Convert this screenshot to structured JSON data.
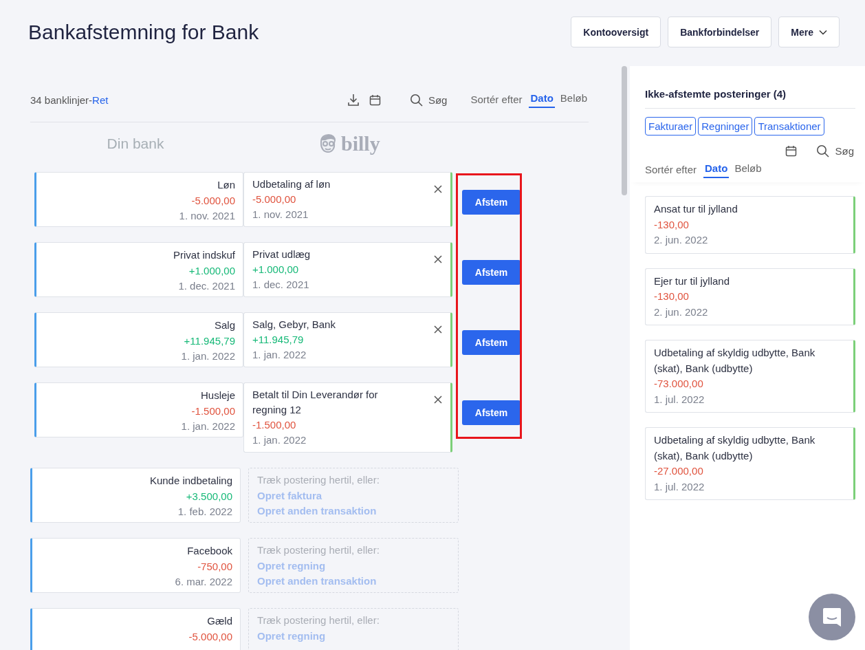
{
  "page": {
    "title": "Bankafstemning for Bank"
  },
  "header_buttons": [
    {
      "label": "Kontooversigt",
      "kind": "plain"
    },
    {
      "label": "Bankforbindelser",
      "kind": "plain"
    },
    {
      "label": "Mere",
      "kind": "dropdown"
    }
  ],
  "toolbar": {
    "count": "34 banklinjer-",
    "edit_link": "Ret",
    "search": "Søg",
    "sort_label": "Sortér efter",
    "sort_options": [
      {
        "label": "Dato",
        "selected": true
      },
      {
        "label": "Beløb",
        "selected": false
      }
    ]
  },
  "columns": {
    "bank": "Din bank",
    "billy": "billy"
  },
  "matched": [
    {
      "bank": {
        "name": "Løn",
        "amount": "-5.000,00",
        "color": "#e0533e",
        "date": "1. nov. 2021"
      },
      "entry": {
        "name": "Udbetaling af løn",
        "amount": "-5.000,00",
        "color": "#e0533e",
        "date": "1. nov. 2021"
      },
      "button": "Afstem"
    },
    {
      "bank": {
        "name": "Privat indskuf",
        "amount": "+1.000,00",
        "color": "#17b978",
        "date": "1. dec. 2021"
      },
      "entry": {
        "name": "Privat udlæg",
        "amount": "+1.000,00",
        "color": "#17b978",
        "date": "1. dec. 2021"
      },
      "button": "Afstem"
    },
    {
      "bank": {
        "name": "Salg",
        "amount": "+11.945,79",
        "color": "#17b978",
        "date": "1. jan. 2022"
      },
      "entry": {
        "name": "Salg, Gebyr, Bank",
        "amount": "+11.945,79",
        "color": "#17b978",
        "date": "1. jan. 2022"
      },
      "button": "Afstem"
    },
    {
      "bank": {
        "name": "Husleje",
        "amount": "-1.500,00",
        "color": "#e0533e",
        "date": "1. jan. 2022"
      },
      "entry": {
        "name": "Betalt til Din Leverandør for regning 12",
        "amount": "-1.500,00",
        "color": "#e0533e",
        "date": "1. jan. 2022"
      },
      "button": "Afstem"
    }
  ],
  "highlight": true,
  "unmatched": [
    {
      "name": "Kunde indbetaling",
      "amount": "+3.500,00",
      "color": "#17b978",
      "date": "1. feb. 2022",
      "hint": "Træk postering hertil, eller:",
      "actions": [
        "Opret faktura",
        "Opret anden transaktion"
      ]
    },
    {
      "name": "Facebook",
      "amount": "-750,00",
      "color": "#e0533e",
      "date": "6. mar. 2022",
      "hint": "Træk postering hertil, eller:",
      "actions": [
        "Opret regning",
        "Opret anden transaktion"
      ]
    },
    {
      "name": "Gæld",
      "amount": "-5.000,00",
      "color": "#e0533e",
      "hint": "Træk postering hertil, eller:",
      "actions": [
        "Opret regning"
      ]
    }
  ],
  "sidebar": {
    "title": "Ikke-afstemte posteringer (4)",
    "filters": [
      "Fakturaer",
      "Regninger",
      "Transaktioner"
    ],
    "search": "Søg",
    "sort_label": "Sortér efter",
    "sort_options": [
      {
        "label": "Dato",
        "selected": true
      },
      {
        "label": "Beløb",
        "selected": false
      }
    ],
    "items": [
      {
        "name": "Ansat tur til jylland",
        "amount": "-130,00",
        "color": "#e0533e",
        "date": "2. jun. 2022"
      },
      {
        "name": "Ejer tur til jylland",
        "amount": "-130,00",
        "color": "#e0533e",
        "date": "2. jun. 2022"
      },
      {
        "name": "Udbetaling af skyldig udbytte, Bank (skat), Bank (udbytte)",
        "amount": "-73.000,00",
        "color": "#e0533e",
        "date": "1. jul. 2022"
      },
      {
        "name": "Udbetaling af skyldig udbytte, Bank (skat), Bank (udbytte)",
        "amount": "-27.000,00",
        "color": "#e0533e",
        "date": "1. jul. 2022"
      }
    ]
  }
}
